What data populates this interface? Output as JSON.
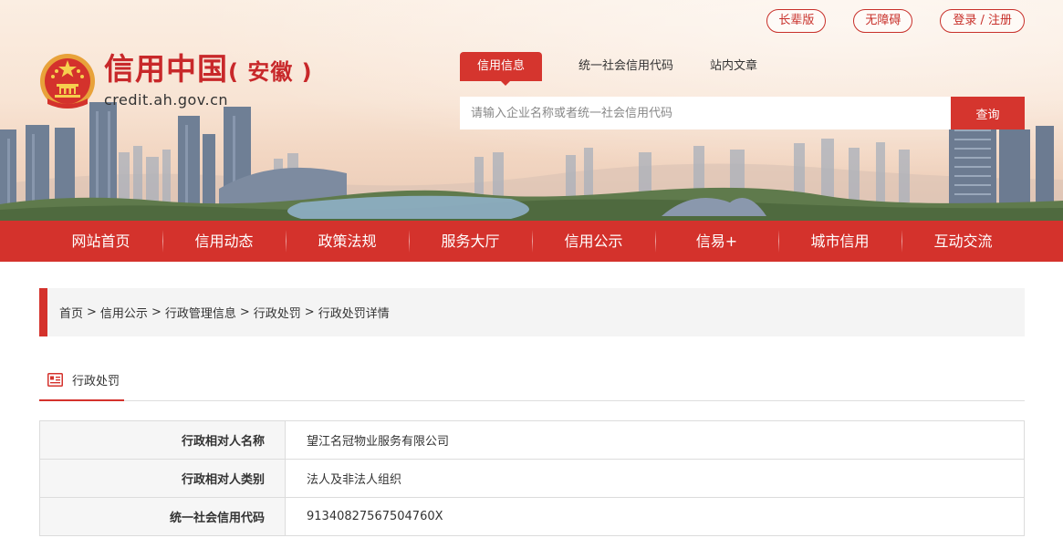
{
  "header": {
    "top_links": [
      "长辈版",
      "无障碍",
      "登录 / 注册"
    ],
    "logo_title": "信用中国",
    "logo_province": "( 安徽 )",
    "logo_url": "credit.ah.gov.cn",
    "search_tabs": [
      "信用信息",
      "统一社会信用代码",
      "站内文章"
    ],
    "search_placeholder": "请输入企业名称或者统一社会信用代码",
    "search_button": "查询"
  },
  "nav": [
    "网站首页",
    "信用动态",
    "政策法规",
    "服务大厅",
    "信用公示",
    "信易+",
    "城市信用",
    "互动交流"
  ],
  "breadcrumb": [
    "首页",
    "信用公示",
    "行政管理信息",
    "行政处罚"
  ],
  "breadcrumb_current": "行政处罚详情",
  "section": {
    "title": "行政处罚"
  },
  "details": [
    {
      "label": "行政相对人名称",
      "value": "望江名冠物业服务有限公司"
    },
    {
      "label": "行政相对人类别",
      "value": "法人及非法人组织"
    },
    {
      "label": "统一社会信用代码",
      "value": "91340827567504760X"
    }
  ],
  "colors": {
    "brand_red": "#d4322c",
    "breadcrumb_bg": "#f4f4f4"
  },
  "icons": {
    "emblem": "national-emblem-icon",
    "section": "document-list-icon"
  }
}
